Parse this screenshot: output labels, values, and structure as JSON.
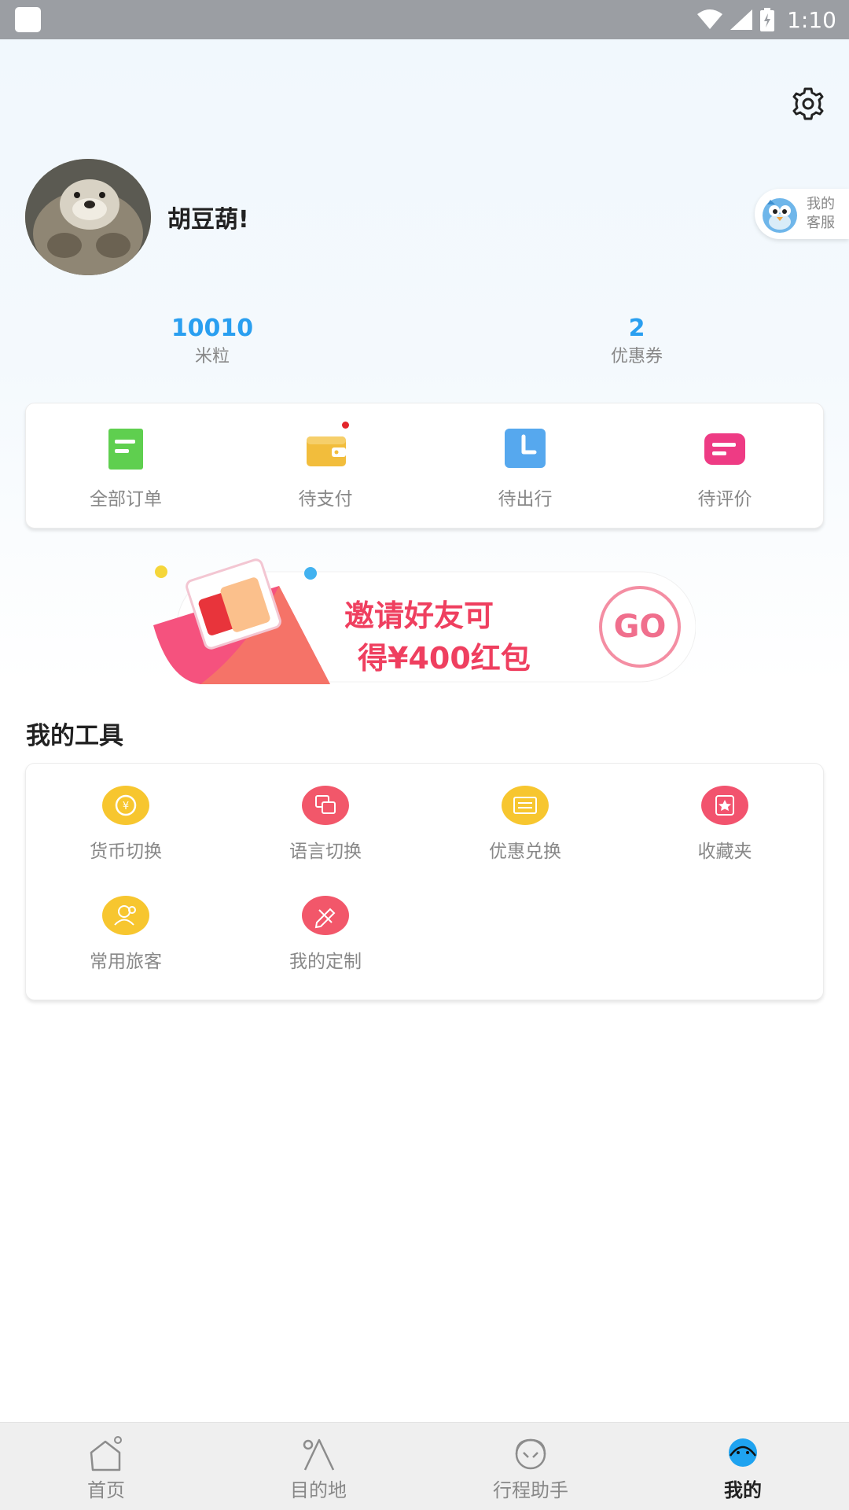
{
  "status_bar": {
    "time": "1:10"
  },
  "profile": {
    "username": "胡豆葫!"
  },
  "customer_service": {
    "label_line1": "我的",
    "label_line2": "客服"
  },
  "stats": [
    {
      "value": "10010",
      "label": "米粒"
    },
    {
      "value": "2",
      "label": "优惠券"
    }
  ],
  "orders": [
    {
      "label": "全部订单",
      "icon": "order-list-icon"
    },
    {
      "label": "待支付",
      "icon": "wallet-icon"
    },
    {
      "label": "待出行",
      "icon": "clock-icon"
    },
    {
      "label": "待评价",
      "icon": "comment-icon"
    }
  ],
  "banner": {
    "line1": "邀请好友可",
    "line2": "得¥400红包",
    "go": "GO"
  },
  "tools_section": {
    "title": "我的工具"
  },
  "tools": [
    {
      "label": "货币切换",
      "icon": "currency-icon"
    },
    {
      "label": "语言切换",
      "icon": "language-icon"
    },
    {
      "label": "优惠兑换",
      "icon": "ticket-icon"
    },
    {
      "label": "收藏夹",
      "icon": "favorites-icon"
    },
    {
      "label": "常用旅客",
      "icon": "travelers-icon"
    },
    {
      "label": "我的定制",
      "icon": "custom-icon"
    }
  ],
  "tabbar": [
    {
      "label": "首页",
      "icon": "home-icon",
      "active": false
    },
    {
      "label": "目的地",
      "icon": "destination-icon",
      "active": false
    },
    {
      "label": "行程助手",
      "icon": "assistant-icon",
      "active": false
    },
    {
      "label": "我的",
      "icon": "profile-icon",
      "active": true
    }
  ],
  "colors": {
    "accent_blue": "#2a9ff0",
    "banner_pink": "#ef3f5f",
    "tool_yellow": "#f7c62f",
    "tool_pink": "#f2536e"
  }
}
